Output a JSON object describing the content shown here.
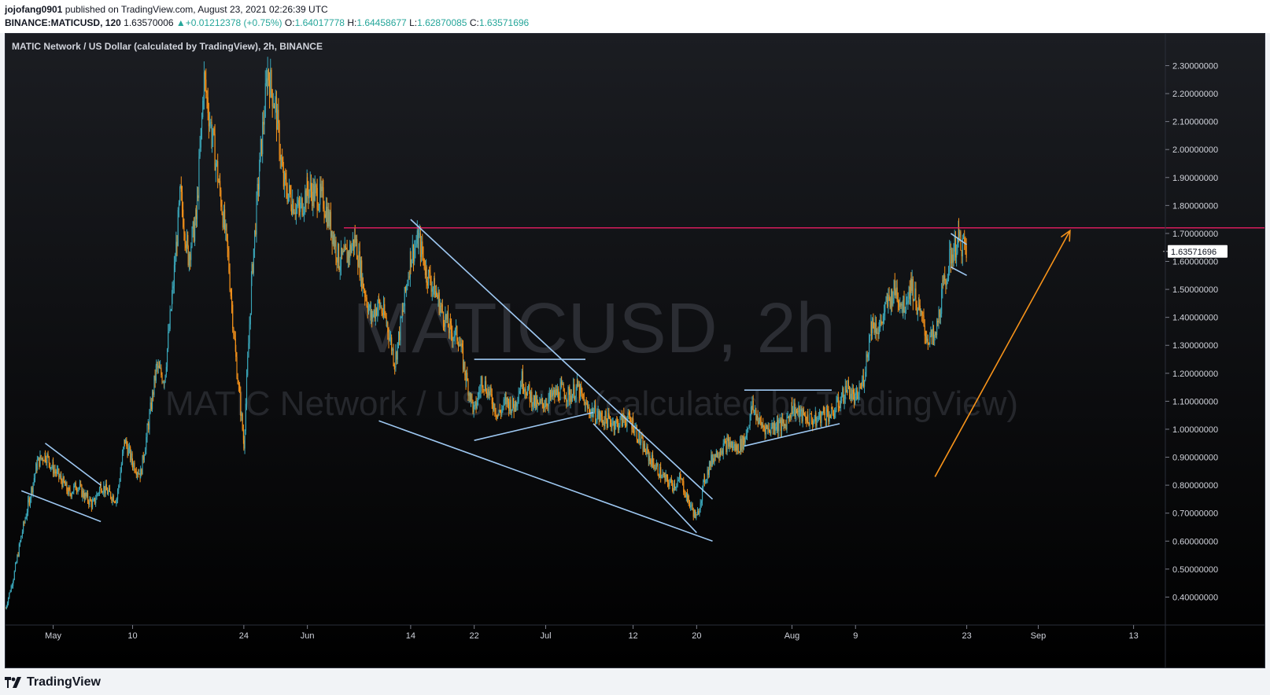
{
  "header": {
    "author": "jojofang0901",
    "published_text": "published on TradingView.com, August 23, 2021 02:26:39 UTC",
    "symbol": "BINANCE:MATICUSD, 120",
    "last_price": "1.63570006",
    "change": "+0.01212378 (+0.75%)",
    "o_label": "O:",
    "o_value": "1.64017778",
    "h_label": "H:",
    "h_value": "1.64458677",
    "l_label": "L:",
    "l_value": "1.62870085",
    "c_label": "C:",
    "c_value": "1.63571696"
  },
  "footer": {
    "brand": "TradingView"
  },
  "colors": {
    "background": "#000000",
    "candle_up": "#3aa6b9",
    "candle_down": "#f7931a",
    "trendline": "#9ec8f2",
    "resistance": "#e91e63",
    "arrow": "#f7931a",
    "price_tag_bg": "#ffffff"
  },
  "chart_data": {
    "type": "candlestick",
    "title": "MATIC Network / US Dollar (calculated by TradingView), 2h, BINANCE",
    "watermark_symbol": "MATICUSD, 2h",
    "watermark_name": "MATIC Network / US Dollar (calculated by TradingView)",
    "ylim": [
      0.3,
      2.38
    ],
    "y_ticks": [
      "2.30000000",
      "2.20000000",
      "2.10000000",
      "2.00000000",
      "1.90000000",
      "1.80000000",
      "1.70000000",
      "1.60000000",
      "1.50000000",
      "1.40000000",
      "1.30000000",
      "1.20000000",
      "1.10000000",
      "1.00000000",
      "0.90000000",
      "0.80000000",
      "0.70000000",
      "0.60000000",
      "0.50000000",
      "0.40000000"
    ],
    "x_ticks": [
      "May",
      "10",
      "24",
      "Jun",
      "14",
      "22",
      "Jul",
      "12",
      "20",
      "Aug",
      "9",
      "23",
      "Sep",
      "13"
    ],
    "current_price": "1.63571696",
    "resistance_level": 1.72,
    "grid": false,
    "price_path": [
      [
        "Apr 24",
        0.36
      ],
      [
        "Apr 25",
        0.47
      ],
      [
        "Apr 26",
        0.62
      ],
      [
        "Apr 27",
        0.75
      ],
      [
        "Apr 28",
        0.88
      ],
      [
        "Apr 29",
        0.91
      ],
      [
        "Apr 30",
        0.86
      ],
      [
        "May 1",
        0.82
      ],
      [
        "May 2",
        0.77
      ],
      [
        "May 3",
        0.8
      ],
      [
        "May 4",
        0.76
      ],
      [
        "May 5",
        0.73
      ],
      [
        "May 6",
        0.8
      ],
      [
        "May 7",
        0.77
      ],
      [
        "May 8",
        0.75
      ],
      [
        "May 9",
        0.96
      ],
      [
        "May 10",
        0.88
      ],
      [
        "May 11",
        0.84
      ],
      [
        "May 12",
        1.02
      ],
      [
        "May 13",
        1.22
      ],
      [
        "May 14",
        1.18
      ],
      [
        "May 15",
        1.48
      ],
      [
        "May 16",
        1.84
      ],
      [
        "May 17",
        1.62
      ],
      [
        "May 18",
        1.75
      ],
      [
        "May 19",
        2.25
      ],
      [
        "May 20",
        2.05
      ],
      [
        "May 21",
        1.85
      ],
      [
        "May 22",
        1.62
      ],
      [
        "May 23",
        1.25
      ],
      [
        "May 24",
        0.95
      ],
      [
        "May 25",
        1.55
      ],
      [
        "May 26",
        1.95
      ],
      [
        "May 27",
        2.28
      ],
      [
        "May 28",
        2.15
      ],
      [
        "May 29",
        1.88
      ],
      [
        "May 30",
        1.82
      ],
      [
        "May 31",
        1.78
      ],
      [
        "Jun 1",
        1.86
      ],
      [
        "Jun 2",
        1.84
      ],
      [
        "Jun 3",
        1.82
      ],
      [
        "Jun 4",
        1.72
      ],
      [
        "Jun 5",
        1.6
      ],
      [
        "Jun 6",
        1.62
      ],
      [
        "Jun 7",
        1.68
      ],
      [
        "Jun 8",
        1.52
      ],
      [
        "Jun 9",
        1.4
      ],
      [
        "Jun 10",
        1.45
      ],
      [
        "Jun 11",
        1.38
      ],
      [
        "Jun 12",
        1.24
      ],
      [
        "Jun 13",
        1.42
      ],
      [
        "Jun 14",
        1.62
      ],
      [
        "Jun 15",
        1.68
      ],
      [
        "Jun 16",
        1.56
      ],
      [
        "Jun 17",
        1.5
      ],
      [
        "Jun 18",
        1.42
      ],
      [
        "Jun 19",
        1.35
      ],
      [
        "Jun 20",
        1.33
      ],
      [
        "Jun 21",
        1.18
      ],
      [
        "Jun 22",
        1.06
      ],
      [
        "Jun 23",
        1.18
      ],
      [
        "Jun 24",
        1.12
      ],
      [
        "Jun 25",
        1.05
      ],
      [
        "Jun 26",
        1.1
      ],
      [
        "Jun 27",
        1.08
      ],
      [
        "Jun 28",
        1.18
      ],
      [
        "Jun 29",
        1.12
      ],
      [
        "Jun 30",
        1.08
      ],
      [
        "Jul 1",
        1.1
      ],
      [
        "Jul 2",
        1.12
      ],
      [
        "Jul 3",
        1.14
      ],
      [
        "Jul 4",
        1.12
      ],
      [
        "Jul 5",
        1.15
      ],
      [
        "Jul 6",
        1.08
      ],
      [
        "Jul 7",
        1.06
      ],
      [
        "Jul 8",
        1.04
      ],
      [
        "Jul 9",
        1.03
      ],
      [
        "Jul 10",
        1.02
      ],
      [
        "Jul 11",
        1.04
      ],
      [
        "Jul 12",
        1.02
      ],
      [
        "Jul 13",
        0.95
      ],
      [
        "Jul 14",
        0.9
      ],
      [
        "Jul 15",
        0.86
      ],
      [
        "Jul 16",
        0.82
      ],
      [
        "Jul 17",
        0.8
      ],
      [
        "Jul 18",
        0.82
      ],
      [
        "Jul 19",
        0.74
      ],
      [
        "Jul 20",
        0.68
      ],
      [
        "Jul 21",
        0.82
      ],
      [
        "Jul 22",
        0.9
      ],
      [
        "Jul 23",
        0.93
      ],
      [
        "Jul 24",
        0.95
      ],
      [
        "Jul 25",
        0.93
      ],
      [
        "Jul 26",
        0.96
      ],
      [
        "Jul 27",
        1.08
      ],
      [
        "Jul 28",
        1.02
      ],
      [
        "Jul 29",
        1.0
      ],
      [
        "Jul 30",
        1.02
      ],
      [
        "Jul 31",
        1.01
      ],
      [
        "Aug 1",
        1.08
      ],
      [
        "Aug 2",
        1.05
      ],
      [
        "Aug 3",
        1.04
      ],
      [
        "Aug 4",
        1.03
      ],
      [
        "Aug 5",
        1.06
      ],
      [
        "Aug 6",
        1.05
      ],
      [
        "Aug 7",
        1.1
      ],
      [
        "Aug 8",
        1.15
      ],
      [
        "Aug 9",
        1.1
      ],
      [
        "Aug 10",
        1.18
      ],
      [
        "Aug 11",
        1.38
      ],
      [
        "Aug 12",
        1.36
      ],
      [
        "Aug 13",
        1.45
      ],
      [
        "Aug 14",
        1.5
      ],
      [
        "Aug 15",
        1.44
      ],
      [
        "Aug 16",
        1.52
      ],
      [
        "Aug 17",
        1.42
      ],
      [
        "Aug 18",
        1.33
      ],
      [
        "Aug 19",
        1.32
      ],
      [
        "Aug 20",
        1.5
      ],
      [
        "Aug 21",
        1.62
      ],
      [
        "Aug 22",
        1.68
      ],
      [
        "Aug 23",
        1.636
      ]
    ],
    "annotations": [
      {
        "kind": "wedge_upper",
        "from": [
          "Apr 29",
          0.95
        ],
        "to": [
          "May 6",
          0.8
        ]
      },
      {
        "kind": "wedge_lower",
        "from": [
          "Apr 26",
          0.78
        ],
        "to": [
          "May 6",
          0.67
        ]
      },
      {
        "kind": "falling_wedge_upper",
        "from": [
          "Jun 14",
          1.75
        ],
        "to": [
          "Jul 22",
          0.75
        ]
      },
      {
        "kind": "falling_wedge_lower",
        "from": [
          "Jun 10",
          1.03
        ],
        "to": [
          "Jul 22",
          0.6
        ]
      },
      {
        "kind": "range_top",
        "from": [
          "Jun 22",
          1.25
        ],
        "to": [
          "Jul 6",
          1.25
        ]
      },
      {
        "kind": "range_bottom",
        "from": [
          "Jun 22",
          0.96
        ],
        "to": [
          "Jul 7",
          1.06
        ]
      },
      {
        "kind": "channel_lower",
        "from": [
          "Jul 7",
          1.02
        ],
        "to": [
          "Jul 20",
          0.63
        ]
      },
      {
        "kind": "range_top",
        "from": [
          "Jul 26",
          1.14
        ],
        "to": [
          "Aug 6",
          1.14
        ]
      },
      {
        "kind": "range_bottom",
        "from": [
          "Jul 26",
          0.94
        ],
        "to": [
          "Aug 7",
          1.02
        ]
      },
      {
        "kind": "flag_upper",
        "from": [
          "Aug 21",
          1.7
        ],
        "to": [
          "Aug 23",
          1.66
        ]
      },
      {
        "kind": "flag_lower",
        "from": [
          "Aug 21",
          1.58
        ],
        "to": [
          "Aug 23",
          1.55
        ]
      },
      {
        "kind": "target_arrow",
        "from": [
          "Aug 19",
          0.83
        ],
        "to": [
          "Sep 5",
          1.71
        ]
      }
    ]
  }
}
